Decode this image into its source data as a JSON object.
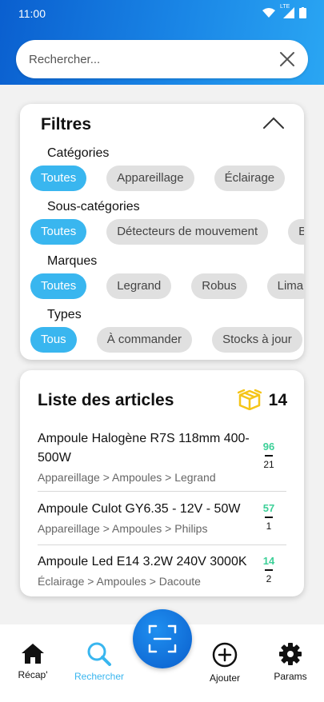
{
  "status_bar": {
    "time": "11:00",
    "network": "LTE"
  },
  "search": {
    "placeholder": "Rechercher..."
  },
  "filters": {
    "title": "Filtres",
    "groups": [
      {
        "label": "Catégories",
        "chips": [
          "Toutes",
          "Appareillage",
          "Éclairage"
        ],
        "selected": "Toutes"
      },
      {
        "label": "Sous-catégories",
        "chips": [
          "Toutes",
          "Détecteurs de mouvement",
          "B"
        ],
        "selected": "Toutes"
      },
      {
        "label": "Marques",
        "chips": [
          "Toutes",
          "Legrand",
          "Robus",
          "Lima"
        ],
        "selected": "Toutes"
      },
      {
        "label": "Types",
        "chips": [
          "Tous",
          "À commander",
          "Stocks à jour"
        ],
        "selected": "Tous"
      }
    ]
  },
  "articles": {
    "title": "Liste des articles",
    "count": "14",
    "items": [
      {
        "name": "Ampoule Halogène R7S 118mm 400-500W",
        "path": "Appareillage > Ampoules > Legrand",
        "stock": "96",
        "min": "21"
      },
      {
        "name": "Ampoule Culot GY6.35 - 12V - 50W",
        "path": "Appareillage > Ampoules > Philips",
        "stock": "57",
        "min": "1"
      },
      {
        "name": "Ampoule Led E14 3.2W 240V 3000K",
        "path": "Éclairage > Ampoules > Dacoute",
        "stock": "14",
        "min": "2"
      }
    ]
  },
  "nav": {
    "home": "Récap'",
    "search": "Rechercher",
    "add": "Ajouter",
    "settings": "Params"
  },
  "colors": {
    "accent": "#39b6ef",
    "header": "#1a86e6",
    "stock_ok": "#3dd098",
    "box_icon": "#f5c518"
  }
}
